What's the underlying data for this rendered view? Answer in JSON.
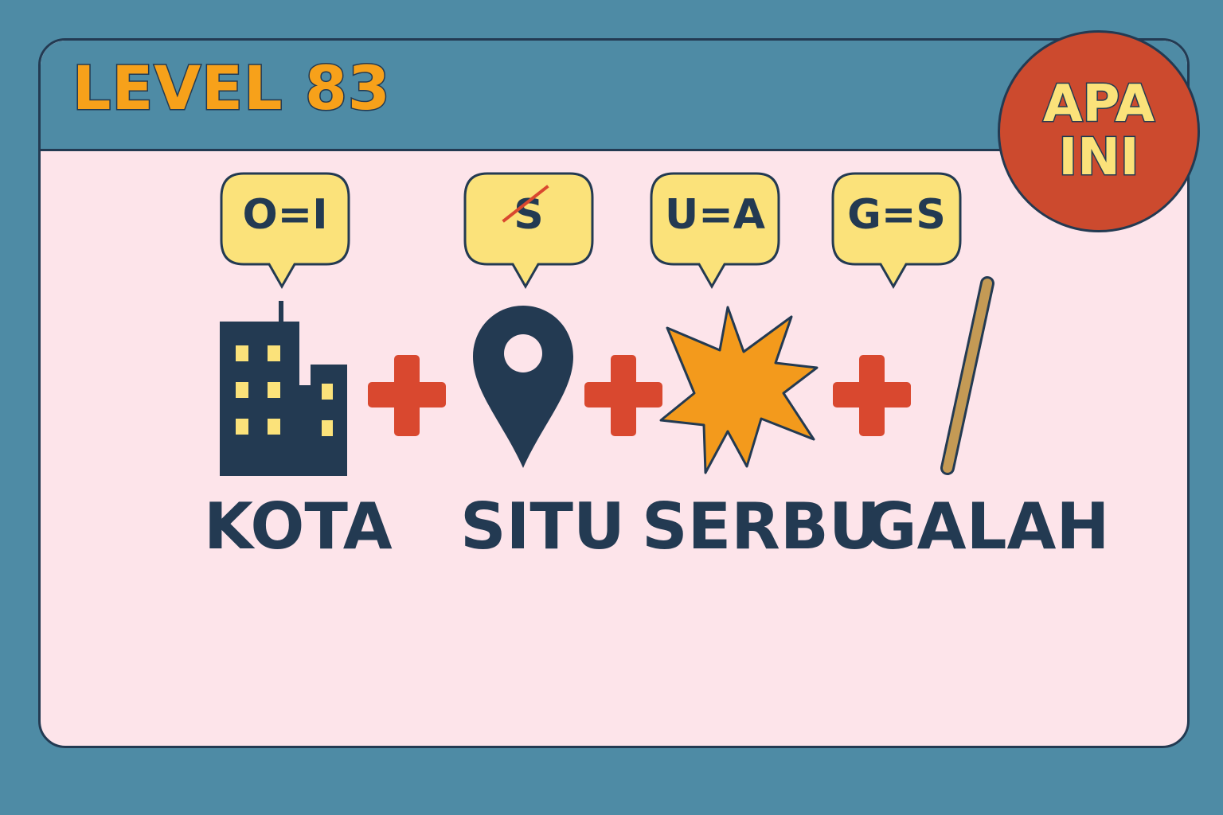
{
  "header": {
    "level_title": "LEVEL 83"
  },
  "badge": {
    "line1": "APA",
    "line2": "INI"
  },
  "clues": [
    {
      "bubble": "O=I",
      "word": "KOTA",
      "icon": "building-icon"
    },
    {
      "bubble": "S",
      "bubble_struck": true,
      "word": "SITU",
      "icon": "location-pin-icon"
    },
    {
      "bubble": "U=A",
      "word": "SERBU",
      "icon": "explosion-icon"
    },
    {
      "bubble": "G=S",
      "word": "GALAH",
      "icon": "pole-icon"
    }
  ],
  "colors": {
    "background": "#4e8ba5",
    "card": "#fde4ea",
    "outline": "#233a52",
    "accent_orange": "#f7a11a",
    "plus_red": "#d9482f",
    "bubble_yellow": "#fbe27a",
    "badge_red": "#cc4a2e",
    "pole_tan": "#c49a55"
  }
}
